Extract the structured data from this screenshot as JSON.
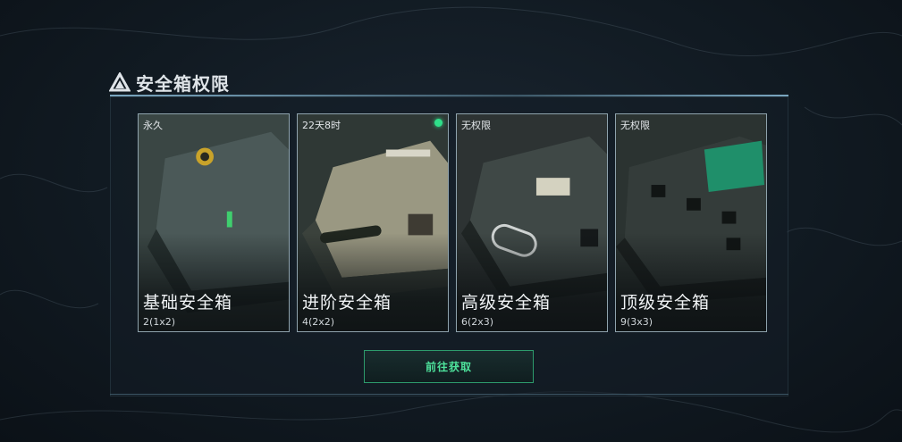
{
  "header": {
    "title": "安全箱权限",
    "icon": "warning-triangle-icon"
  },
  "cards": [
    {
      "status": "永久",
      "name": "基础安全箱",
      "capacity": "2(1x2)",
      "active": false
    },
    {
      "status": "22天8时",
      "name": "进阶安全箱",
      "capacity": "4(2x2)",
      "active": true
    },
    {
      "status": "无权限",
      "name": "高级安全箱",
      "capacity": "6(2x3)",
      "active": false
    },
    {
      "status": "无权限",
      "name": "顶级安全箱",
      "capacity": "9(3x3)",
      "active": false
    }
  ],
  "action": {
    "label": "前往获取"
  },
  "colors": {
    "accent": "#2fe08a",
    "button_text": "#4ee39c",
    "card_border": "#8fa3ad"
  }
}
